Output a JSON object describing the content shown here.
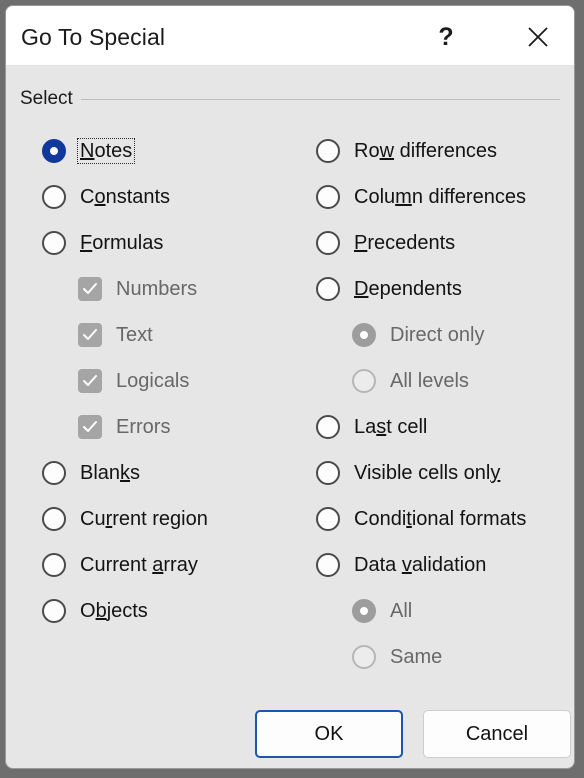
{
  "dialog": {
    "title": "Go To Special",
    "help_icon": "question-mark-icon",
    "close_icon": "close-icon",
    "group_label": "Select"
  },
  "options": {
    "left": [
      {
        "type": "radio",
        "label": "Notes",
        "acc": "N",
        "checked": true,
        "disabled": false,
        "focused": true,
        "indent": false
      },
      {
        "type": "radio",
        "label": "Constants",
        "acc": "o",
        "checked": false,
        "disabled": false,
        "focused": false,
        "indent": false
      },
      {
        "type": "radio",
        "label": "Formulas",
        "acc": "F",
        "checked": false,
        "disabled": false,
        "focused": false,
        "indent": false
      },
      {
        "type": "checkbox",
        "label": "Numbers",
        "acc": "",
        "checked": true,
        "disabled": true,
        "focused": false,
        "indent": true
      },
      {
        "type": "checkbox",
        "label": "Text",
        "acc": "",
        "checked": true,
        "disabled": true,
        "focused": false,
        "indent": true
      },
      {
        "type": "checkbox",
        "label": "Logicals",
        "acc": "",
        "checked": true,
        "disabled": true,
        "focused": false,
        "indent": true
      },
      {
        "type": "checkbox",
        "label": "Errors",
        "acc": "",
        "checked": true,
        "disabled": true,
        "focused": false,
        "indent": true
      },
      {
        "type": "radio",
        "label": "Blanks",
        "acc": "k",
        "checked": false,
        "disabled": false,
        "focused": false,
        "indent": false
      },
      {
        "type": "radio",
        "label": "Current region",
        "acc": "r",
        "checked": false,
        "disabled": false,
        "focused": false,
        "indent": false
      },
      {
        "type": "radio",
        "label": "Current array",
        "acc": "a",
        "checked": false,
        "disabled": false,
        "focused": false,
        "indent": false
      },
      {
        "type": "radio",
        "label": "Objects",
        "acc": "b",
        "checked": false,
        "disabled": false,
        "focused": false,
        "indent": false
      }
    ],
    "right": [
      {
        "type": "radio",
        "label": "Row differences",
        "acc": "w",
        "checked": false,
        "disabled": false,
        "focused": false,
        "indent": false
      },
      {
        "type": "radio",
        "label": "Column differences",
        "acc": "m",
        "checked": false,
        "disabled": false,
        "focused": false,
        "indent": false
      },
      {
        "type": "radio",
        "label": "Precedents",
        "acc": "P",
        "checked": false,
        "disabled": false,
        "focused": false,
        "indent": false
      },
      {
        "type": "radio",
        "label": "Dependents",
        "acc": "D",
        "checked": false,
        "disabled": false,
        "focused": false,
        "indent": false
      },
      {
        "type": "radio",
        "label": "Direct only",
        "acc": "",
        "checked": true,
        "disabled": true,
        "focused": false,
        "indent": true
      },
      {
        "type": "radio",
        "label": "All levels",
        "acc": "",
        "checked": false,
        "disabled": true,
        "focused": false,
        "indent": true
      },
      {
        "type": "radio",
        "label": "Last cell",
        "acc": "s",
        "checked": false,
        "disabled": false,
        "focused": false,
        "indent": false
      },
      {
        "type": "radio",
        "label": "Visible cells only",
        "acc": "y",
        "checked": false,
        "disabled": false,
        "focused": false,
        "indent": false
      },
      {
        "type": "radio",
        "label": "Conditional formats",
        "acc": "t",
        "checked": false,
        "disabled": false,
        "focused": false,
        "indent": false
      },
      {
        "type": "radio",
        "label": "Data validation",
        "acc": "v",
        "checked": false,
        "disabled": false,
        "focused": false,
        "indent": false
      },
      {
        "type": "radio",
        "label": "All",
        "acc": "",
        "checked": true,
        "disabled": true,
        "focused": false,
        "indent": true
      },
      {
        "type": "radio",
        "label": "Same",
        "acc": "",
        "checked": false,
        "disabled": true,
        "focused": false,
        "indent": true
      }
    ]
  },
  "footer": {
    "ok_label": "OK",
    "cancel_label": "Cancel"
  },
  "colors": {
    "accent_selected": "#10399b",
    "default_button_border": "#1a56b0",
    "dialog_background": "#e6e6e6",
    "titlebar_background": "#ffffff",
    "disabled_control": "#9d9d9d"
  },
  "layout": {
    "left_column_rows_y": [
      130,
      176,
      222,
      268,
      314,
      360,
      406,
      452,
      498,
      544,
      590
    ],
    "right_column_rows_y": [
      130,
      176,
      222,
      268,
      314,
      360,
      406,
      452,
      498,
      544,
      590,
      636
    ]
  }
}
